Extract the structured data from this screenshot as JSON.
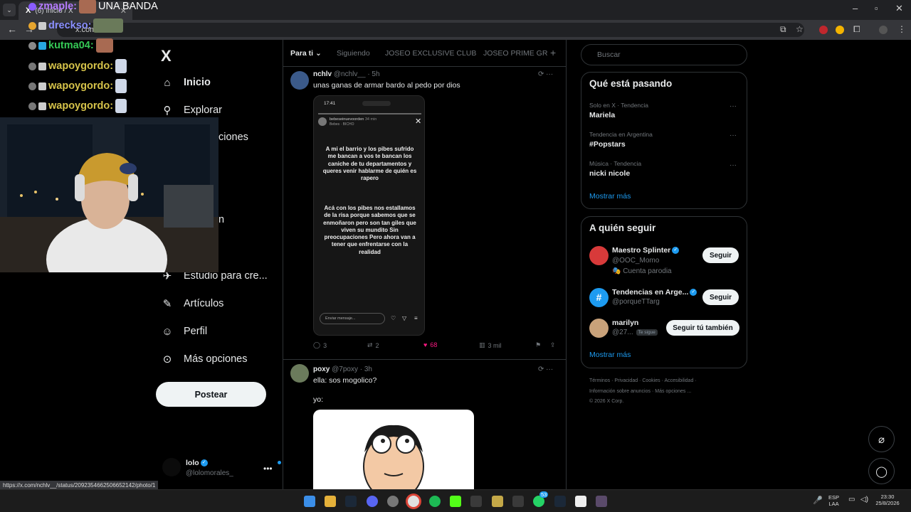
{
  "browser": {
    "tab_title": "(6) Inicio / X",
    "tab_logo": "X",
    "url": "x.com/i",
    "status_url": "https://x.com/nchlv__/status/2092354662506652142/photo/1"
  },
  "left_nav": {
    "logo": "X",
    "items": [
      {
        "label": "Inicio",
        "icon": "home-icon",
        "active": true
      },
      {
        "label": "Explorar",
        "icon": "search-icon"
      },
      {
        "label": "Estudio para cre...",
        "icon": "studio-icon"
      },
      {
        "label": "Artículos",
        "icon": "articles-icon"
      },
      {
        "label": "Perfil",
        "icon": "profile-icon"
      },
      {
        "label": "Más opciones",
        "icon": "more-icon"
      }
    ],
    "peek_labels": [
      "ciones",
      "n"
    ],
    "post_button": "Postear",
    "profile": {
      "name": "lolo",
      "handle": "@lolomorales_"
    }
  },
  "main": {
    "tabs": [
      "Para ti",
      "Siguiendo",
      "JOSEO EXCLUSIVE CLUB",
      "JOSEO PRIME GR"
    ],
    "tweets": [
      {
        "name": "nchlv",
        "handle": "@nchlv__",
        "time": "· 5h",
        "text": "unas ganas de armar bardo al pedo por dios",
        "story": {
          "time": "17:41",
          "user": "bebeseinuevoorden",
          "user_time": "34 min",
          "user_sub": "Bebes · BICHO",
          "paragraph1": "A mi el barrio y los pibes sufrido me bancan a vos te bancan los caniche de tu departamentos y queres venir hablarme de quién es rapero",
          "paragraph2": "Acá con los pibes nos estallamos de la risa porque sabemos que se enmoñaron pero son tan giles que viven su mundito Sin preocupaciones Pero ahora van a tener que enfrentarse con la realidad",
          "input_placeholder": "Enviar mensaje..."
        },
        "replies": "3",
        "retweets": "2",
        "likes": "68",
        "views": "3 mil"
      },
      {
        "name": "poxy",
        "handle": "@7poxy",
        "time": "· 3h",
        "text": "ella: sos mogolico?",
        "text2": "yo:"
      }
    ]
  },
  "right": {
    "search_placeholder": "Buscar",
    "trends_title": "Qué está pasando",
    "trends": [
      {
        "meta": "Solo en X · Tendencia",
        "name": "Mariela"
      },
      {
        "meta": "Tendencia en Argentina",
        "name": "#Popstars"
      },
      {
        "meta": "Música · Tendencia",
        "name": "nicki nicole"
      }
    ],
    "trends_more": "Mostrar más",
    "follow_title": "A quién seguir",
    "follow": [
      {
        "name": "Maestro Splinter",
        "handle": "@OOC_Momo",
        "extra": "🎭 Cuenta parodia",
        "button": "Seguir"
      },
      {
        "name": "Tendencias en Arge...",
        "handle": "@porqueTTarg",
        "button": "Seguir"
      },
      {
        "name": "marilyn",
        "handle": "@27...",
        "badge": "Te sigue",
        "button": "Seguir tú también"
      }
    ],
    "follow_more": "Mostrar más",
    "footer": [
      "Términos",
      "Privacidad",
      "Cookies",
      "Accesibilidad",
      "Información sobre anuncios",
      "Más opciones ...",
      "© 2026 X Corp."
    ]
  },
  "overlay": {
    "chat": [
      {
        "user": "zmaple:",
        "color": "#b57bff",
        "message": "UNA BANDA"
      },
      {
        "user": "dreckso:",
        "color": "#8a8fff",
        "message": ""
      },
      {
        "user": "kutma04:",
        "color": "#35c855",
        "message": ""
      },
      {
        "user": "wapoygordo:",
        "color": "#d6c34a",
        "message": ""
      },
      {
        "user": "wapoygordo:",
        "color": "#d6c34a",
        "message": ""
      },
      {
        "user": "wapoygordo:",
        "color": "#d6c34a",
        "message": ""
      }
    ]
  },
  "taskbar": {
    "lang": "ESP",
    "lang2": "LAA",
    "time": "23:30",
    "date": "25/8/2026",
    "badge_count": "53"
  },
  "colors": {
    "accent": "#1d9bf0",
    "like": "#f91880",
    "background": "#000000"
  }
}
